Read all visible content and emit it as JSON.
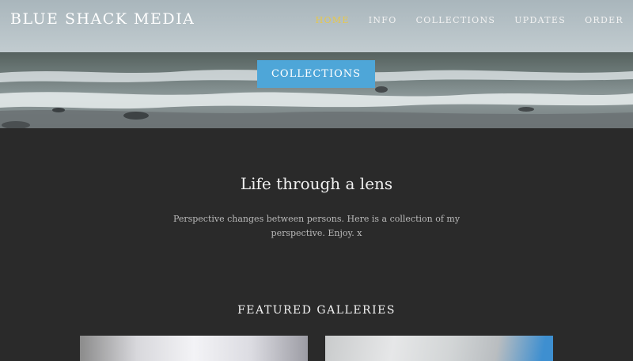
{
  "header": {
    "brand": "BLUE SHACK MEDIA",
    "nav": [
      {
        "label": "HOME",
        "active": true
      },
      {
        "label": "INFO",
        "active": false
      },
      {
        "label": "COLLECTIONS",
        "active": false
      },
      {
        "label": "UPDATES",
        "active": false
      },
      {
        "label": "ORDER",
        "active": false
      }
    ]
  },
  "hero": {
    "button_label": "COLLECTIONS"
  },
  "intro": {
    "title": "Life through a lens",
    "text": "Perspective changes between persons. Here is a collection of my perspective. Enjoy. x"
  },
  "featured": {
    "title": "FEATURED GALLERIES"
  },
  "colors": {
    "accent": "#4ea6d8",
    "active_nav": "#e8c84a",
    "background": "#2a2a2a"
  }
}
